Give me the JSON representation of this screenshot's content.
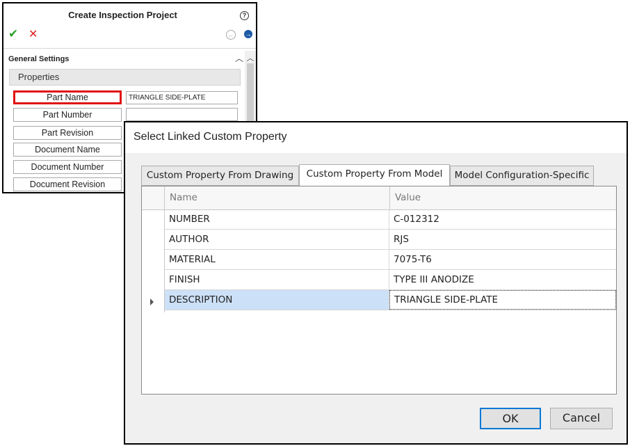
{
  "inspection_panel": {
    "title": "Create Inspection Project",
    "help_icon": "question-circle-icon",
    "confirm_icon": "check-icon",
    "cancel_icon": "x-icon",
    "section_title": "General Settings",
    "properties_header": "Properties",
    "fields": [
      {
        "label": "Part Name",
        "value": "TRIANGLE SIDE-PLATE",
        "highlighted": true
      },
      {
        "label": "Part Number",
        "value": ""
      },
      {
        "label": "Part Revision",
        "value": ""
      },
      {
        "label": "Document Name",
        "value": ""
      },
      {
        "label": "Document Number",
        "value": ""
      },
      {
        "label": "Document Revision",
        "value": ""
      }
    ]
  },
  "dialog": {
    "title": "Select Linked Custom Property",
    "tabs": [
      {
        "label": "Custom Property From Drawing",
        "active": false
      },
      {
        "label": "Custom Property From Model",
        "active": true
      },
      {
        "label": "Model Configuration-Specific",
        "active": false
      }
    ],
    "grid": {
      "columns": [
        "Name",
        "Value"
      ],
      "rows": [
        {
          "name": "NUMBER",
          "value": "C-012312"
        },
        {
          "name": "AUTHOR",
          "value": "RJS"
        },
        {
          "name": "MATERIAL",
          "value": "7075-T6"
        },
        {
          "name": "FINISH",
          "value": "TYPE III ANODIZE"
        },
        {
          "name": "DESCRIPTION",
          "value": "TRIANGLE SIDE-PLATE",
          "selected": true
        }
      ]
    },
    "buttons": {
      "ok": "OK",
      "cancel": "Cancel"
    }
  },
  "colors": {
    "highlight_border": "#e01010",
    "selected_row": "#cce0f7",
    "ok_check": "#2da02d",
    "cancel_x": "#e02020",
    "primary_button_border": "#0078d7"
  }
}
